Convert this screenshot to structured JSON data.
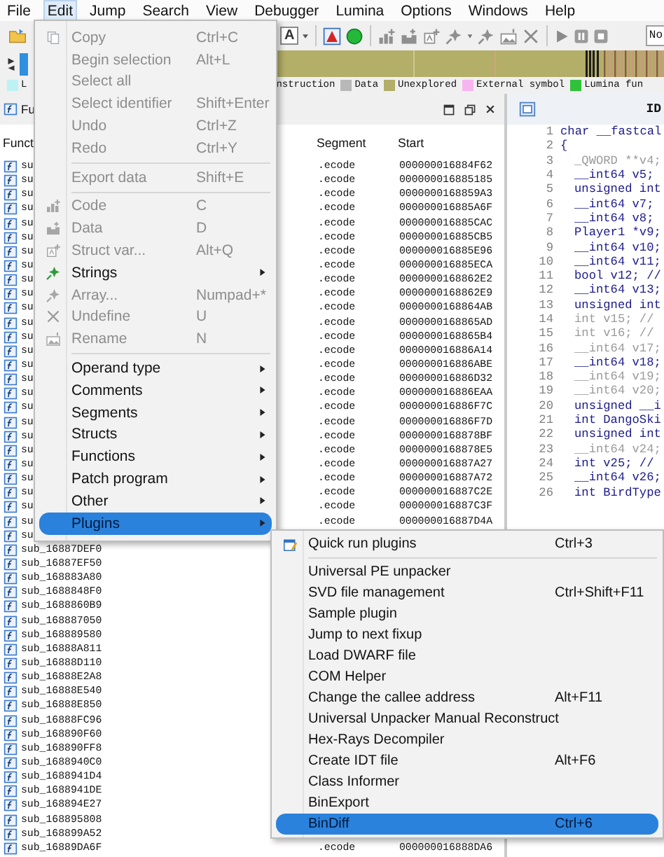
{
  "menubar": [
    {
      "label": "File",
      "selected": false
    },
    {
      "label": "Edit",
      "selected": true
    },
    {
      "label": "Jump",
      "selected": false
    },
    {
      "label": "Search",
      "selected": false
    },
    {
      "label": "View",
      "selected": false
    },
    {
      "label": "Debugger",
      "selected": false
    },
    {
      "label": "Lumina",
      "selected": false
    },
    {
      "label": "Options",
      "selected": false
    },
    {
      "label": "Windows",
      "selected": false
    },
    {
      "label": "Help",
      "selected": false
    }
  ],
  "toolbar": {
    "font_button": "A",
    "debugger_select": "No"
  },
  "legend": [
    {
      "label": "L",
      "color": "#bdf2f5"
    },
    {
      "label": "nstruction"
    },
    {
      "label": "Data",
      "color": "#b8b8b8"
    },
    {
      "label": "Unexplored",
      "color": "#b3ae68"
    },
    {
      "label": "External symbol",
      "color": "#f7b5f0"
    },
    {
      "label": "Lumina fun",
      "color": "#2fc23a"
    }
  ],
  "functions_window": {
    "tab": "Fu",
    "columns": [
      "Funct",
      "Segment",
      "Start"
    ],
    "rows": [
      {
        "name": "su",
        "segment": ".ecode",
        "start": "000000016884F62"
      },
      {
        "name": "su",
        "segment": ".ecode",
        "start": "000000016885185"
      },
      {
        "name": "su",
        "segment": ".ecode",
        "start": "0000000168859A3"
      },
      {
        "name": "su",
        "segment": ".ecode",
        "start": "000000016885A6F"
      },
      {
        "name": "su",
        "segment": ".ecode",
        "start": "000000016885CAC"
      },
      {
        "name": "su",
        "segment": ".ecode",
        "start": "000000016885CB5"
      },
      {
        "name": "su",
        "segment": ".ecode",
        "start": "000000016885E96"
      },
      {
        "name": "su",
        "segment": ".ecode",
        "start": "000000016885ECA"
      },
      {
        "name": "su",
        "segment": ".ecode",
        "start": "0000000168862E2"
      },
      {
        "name": "su",
        "segment": ".ecode",
        "start": "0000000168862E9"
      },
      {
        "name": "su",
        "segment": ".ecode",
        "start": "0000000168864AB"
      },
      {
        "name": "su",
        "segment": ".ecode",
        "start": "0000000168865AD"
      },
      {
        "name": "su",
        "segment": ".ecode",
        "start": "0000000168865B4"
      },
      {
        "name": "su",
        "segment": ".ecode",
        "start": "000000016886A14"
      },
      {
        "name": "su",
        "segment": ".ecode",
        "start": "000000016886ABE"
      },
      {
        "name": "su",
        "segment": ".ecode",
        "start": "000000016886D32"
      },
      {
        "name": "su",
        "segment": ".ecode",
        "start": "000000016886EAA"
      },
      {
        "name": "su",
        "segment": ".ecode",
        "start": "000000016886F7C"
      },
      {
        "name": "su",
        "segment": ".ecode",
        "start": "000000016886F7D"
      },
      {
        "name": "su",
        "segment": ".ecode",
        "start": "0000000168878BF"
      },
      {
        "name": "su",
        "segment": ".ecode",
        "start": "0000000168878E5"
      },
      {
        "name": "su",
        "segment": ".ecode",
        "start": "000000016887A27"
      },
      {
        "name": "su",
        "segment": ".ecode",
        "start": "000000016887A72"
      },
      {
        "name": "su",
        "segment": ".ecode",
        "start": "000000016887C2E"
      },
      {
        "name": "su",
        "segment": ".ecode",
        "start": "000000016887C3F"
      },
      {
        "name": "su",
        "segment": ".ecode",
        "start": "000000016887D4A"
      },
      {
        "name": "su"
      },
      {
        "name": "sub_16887DEF0"
      },
      {
        "name": "sub_16887EF50"
      },
      {
        "name": "sub_168883A80"
      },
      {
        "name": "sub_1688848F0"
      },
      {
        "name": "sub_1688860B9"
      },
      {
        "name": "sub_168887050"
      },
      {
        "name": "sub_168889580"
      },
      {
        "name": "sub_16888A811"
      },
      {
        "name": "sub_16888D110"
      },
      {
        "name": "sub_16888E2A8"
      },
      {
        "name": "sub_16888E540"
      },
      {
        "name": "sub_16888E850"
      },
      {
        "name": "sub_16888FC96"
      },
      {
        "name": "sub_168890F60"
      },
      {
        "name": "sub_168890FF8"
      },
      {
        "name": "sub_1688940C0"
      },
      {
        "name": "sub_1688941D4"
      },
      {
        "name": "sub_1688941DE"
      },
      {
        "name": "sub_168894E27"
      },
      {
        "name": "sub_168895808"
      },
      {
        "name": "sub_168899A52"
      },
      {
        "name": "sub_16889DA6F",
        "segment": ".ecode",
        "start": "000000016888DA6"
      }
    ]
  },
  "pseudocode": {
    "tab": "ID",
    "lines": [
      {
        "number": "1",
        "text": "char __fastcal",
        "kind": "signature",
        "greyed": false
      },
      {
        "number": "2",
        "text": "{",
        "kind": "signature",
        "greyed": false
      },
      {
        "number": "3",
        "text": "_QWORD **v4;",
        "kind": "declaration",
        "greyed": true
      },
      {
        "number": "4",
        "text": "__int64 v5;",
        "kind": "declaration",
        "greyed": false
      },
      {
        "number": "5",
        "text": "unsigned int",
        "kind": "declaration",
        "greyed": false
      },
      {
        "number": "6",
        "text": "__int64 v7;",
        "kind": "declaration",
        "greyed": false
      },
      {
        "number": "7",
        "text": "__int64 v8;",
        "kind": "declaration",
        "greyed": false
      },
      {
        "number": "8",
        "text": "Player1 *v9;",
        "kind": "declaration",
        "greyed": false
      },
      {
        "number": "9",
        "text": "__int64 v10;",
        "kind": "declaration",
        "greyed": false
      },
      {
        "number": "10",
        "text": "__int64 v11;",
        "kind": "declaration",
        "greyed": false
      },
      {
        "number": "11",
        "text": "bool v12; //",
        "kind": "declaration",
        "greyed": false
      },
      {
        "number": "12",
        "text": "__int64 v13;",
        "kind": "declaration",
        "greyed": false
      },
      {
        "number": "13",
        "text": "unsigned int",
        "kind": "declaration",
        "greyed": false
      },
      {
        "number": "14",
        "text": "int v15; //",
        "kind": "declaration",
        "greyed": true
      },
      {
        "number": "15",
        "text": "int v16; //",
        "kind": "declaration",
        "greyed": true
      },
      {
        "number": "16",
        "text": "__int64 v17;",
        "kind": "declaration",
        "greyed": true
      },
      {
        "number": "17",
        "text": "__int64 v18;",
        "kind": "declaration",
        "greyed": false
      },
      {
        "number": "18",
        "text": "__int64 v19;",
        "kind": "declaration",
        "greyed": true
      },
      {
        "number": "19",
        "text": "__int64 v20;",
        "kind": "declaration",
        "greyed": true
      },
      {
        "number": "20",
        "text": "unsigned __i",
        "kind": "declaration",
        "greyed": false
      },
      {
        "number": "21",
        "text": "int DangoSki",
        "kind": "declaration",
        "greyed": false
      },
      {
        "number": "22",
        "text": "unsigned int",
        "kind": "declaration",
        "greyed": false
      },
      {
        "number": "23",
        "text": "__int64 v24;",
        "kind": "declaration",
        "greyed": true
      },
      {
        "number": "24",
        "text": "int v25; //",
        "kind": "declaration",
        "greyed": false
      },
      {
        "number": "25",
        "text": "__int64 v26;",
        "kind": "declaration",
        "greyed": false
      },
      {
        "number": "26",
        "text": "int BirdType",
        "kind": "declaration",
        "greyed": false
      }
    ]
  },
  "edit_menu": [
    {
      "label": "Copy",
      "shortcut": "Ctrl+C",
      "kind": "item",
      "disabled": true,
      "selected": false
    },
    {
      "label": "Begin selection",
      "shortcut": "Alt+L",
      "kind": "item",
      "disabled": true,
      "selected": false
    },
    {
      "label": "Select all",
      "kind": "item",
      "disabled": true,
      "selected": false
    },
    {
      "label": "Select identifier",
      "shortcut": "Shift+Enter",
      "kind": "item",
      "disabled": true,
      "selected": false
    },
    {
      "label": "Undo",
      "shortcut": "Ctrl+Z",
      "kind": "item",
      "disabled": true,
      "selected": false
    },
    {
      "label": "Redo",
      "shortcut": "Ctrl+Y",
      "kind": "item",
      "disabled": true,
      "selected": false
    },
    {
      "kind": "separator"
    },
    {
      "label": "Export data",
      "shortcut": "Shift+E",
      "kind": "item",
      "disabled": true,
      "selected": false
    },
    {
      "kind": "separator"
    },
    {
      "label": "Code",
      "shortcut": "C",
      "kind": "item",
      "disabled": true,
      "selected": false
    },
    {
      "label": "Data",
      "shortcut": "D",
      "kind": "item",
      "disabled": true,
      "selected": false
    },
    {
      "label": "Struct var...",
      "shortcut": "Alt+Q",
      "kind": "item",
      "disabled": true,
      "selected": false
    },
    {
      "label": "Strings",
      "kind": "submenu",
      "disabled": false,
      "selected": false
    },
    {
      "label": "Array...",
      "shortcut": "Numpad+*",
      "kind": "item",
      "disabled": true,
      "selected": false
    },
    {
      "label": "Undefine",
      "shortcut": "U",
      "kind": "item",
      "disabled": true,
      "selected": false
    },
    {
      "label": "Rename",
      "shortcut": "N",
      "kind": "item",
      "disabled": true,
      "selected": false
    },
    {
      "kind": "separator"
    },
    {
      "label": "Operand type",
      "kind": "submenu",
      "disabled": false,
      "selected": false
    },
    {
      "label": "Comments",
      "kind": "submenu",
      "disabled": false,
      "selected": false
    },
    {
      "label": "Segments",
      "kind": "submenu",
      "disabled": false,
      "selected": false
    },
    {
      "label": "Structs",
      "kind": "submenu",
      "disabled": false,
      "selected": false
    },
    {
      "label": "Functions",
      "kind": "submenu",
      "disabled": false,
      "selected": false
    },
    {
      "label": "Patch program",
      "kind": "submenu",
      "disabled": false,
      "selected": false
    },
    {
      "label": "Other",
      "kind": "submenu",
      "disabled": false,
      "selected": false
    },
    {
      "label": "Plugins",
      "kind": "submenu",
      "disabled": false,
      "selected": true
    }
  ],
  "plugins_menu": [
    {
      "label": "Quick run plugins",
      "shortcut": "Ctrl+3",
      "kind": "item",
      "disabled": false,
      "selected": false
    },
    {
      "kind": "separator"
    },
    {
      "label": "Universal PE unpacker",
      "kind": "item",
      "disabled": false,
      "selected": false
    },
    {
      "label": "SVD file management",
      "shortcut": "Ctrl+Shift+F11",
      "kind": "item",
      "disabled": false,
      "selected": false
    },
    {
      "label": "Sample plugin",
      "kind": "item",
      "disabled": false,
      "selected": false
    },
    {
      "label": "Jump to next fixup",
      "kind": "item",
      "disabled": false,
      "selected": false
    },
    {
      "label": "Load DWARF file",
      "kind": "item",
      "disabled": false,
      "selected": false
    },
    {
      "label": "COM Helper",
      "kind": "item",
      "disabled": false,
      "selected": false
    },
    {
      "label": "Change the callee address",
      "shortcut": "Alt+F11",
      "kind": "item",
      "disabled": false,
      "selected": false
    },
    {
      "label": "Universal Unpacker Manual Reconstruct",
      "kind": "item",
      "disabled": false,
      "selected": false
    },
    {
      "label": "Hex-Rays Decompiler",
      "kind": "item",
      "disabled": false,
      "selected": false
    },
    {
      "label": "Create IDT file",
      "shortcut": "Alt+F6",
      "kind": "item",
      "disabled": false,
      "selected": false
    },
    {
      "label": "Class Informer",
      "kind": "item",
      "disabled": false,
      "selected": false
    },
    {
      "label": "BinExport",
      "kind": "item",
      "disabled": false,
      "selected": false
    },
    {
      "label": "BinDiff",
      "shortcut": "Ctrl+6",
      "kind": "item",
      "disabled": false,
      "selected": true
    }
  ]
}
